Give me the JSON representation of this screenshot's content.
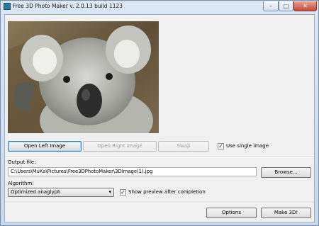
{
  "window": {
    "title": "Free 3D Photo Maker  v. 2.0.13 build 1123",
    "min_glyph": "–",
    "max_glyph": "□",
    "close_glyph": "✕"
  },
  "preview": {
    "description_icon": "koala-photo"
  },
  "buttons": {
    "open_left": "Open Left Image",
    "open_right": "Open Right Image",
    "swap": "Swap",
    "browse": "Browse...",
    "options": "Options",
    "make3d": "Make 3D!"
  },
  "single_image": {
    "label": "Use single image",
    "checked": true,
    "mark": "✓"
  },
  "output": {
    "label": "Output file:",
    "value": "C:\\Users\\MuKa\\Pictures\\Free3DPhotoMaker\\3DImage(1).jpg"
  },
  "algorithm": {
    "label": "Algorithm:",
    "selected": "Optimized anaglyph",
    "arrow": "▾"
  },
  "show_preview": {
    "label": "Show preview after completion",
    "checked": true,
    "mark": "✓"
  },
  "colors": {
    "accent": "#3c7fb1",
    "window_frame": "#c7d8ec",
    "close": "#c34a38"
  }
}
